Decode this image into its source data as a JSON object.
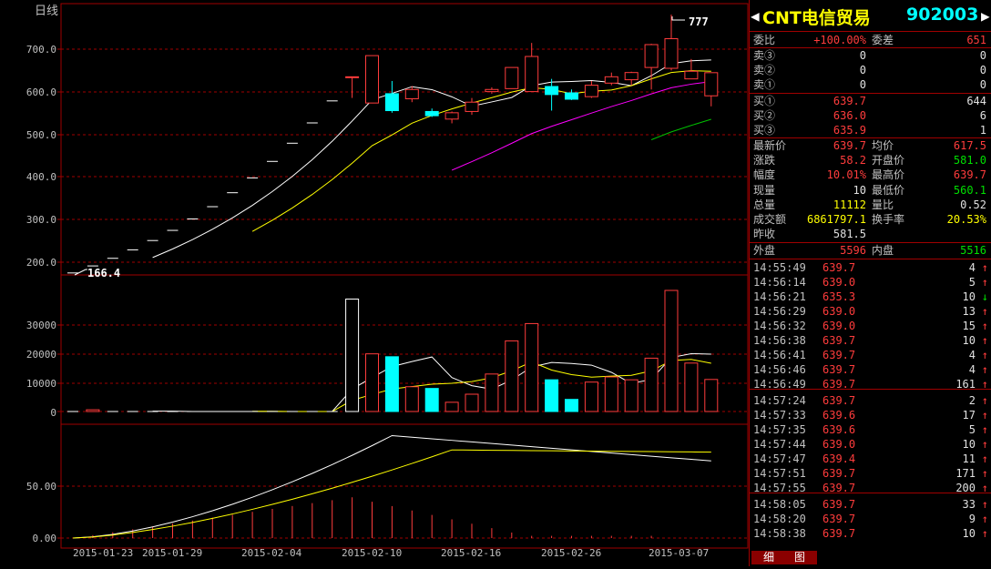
{
  "chart": {
    "period_label": "日线",
    "high_marker": "777",
    "low_marker": "166.4",
    "price_ticks": [
      "700.0",
      "600.0",
      "500.0",
      "400.0",
      "300.0",
      "200.0"
    ],
    "volume_ticks": [
      "30000",
      "20000",
      "10000",
      "0"
    ],
    "indicator_ticks": [
      "50.00",
      "0.00"
    ],
    "date_labels": [
      "2015-01-23",
      "2015-01-29",
      "2015-02-04",
      "2015-02-10",
      "2015-02-16",
      "2015-02-26",
      "2015-03-07"
    ]
  },
  "chart_data": {
    "type": "candlestick",
    "price_axis_range": [
      166,
      777
    ],
    "volume_axis_range": [
      0,
      40000
    ],
    "candles": [
      {
        "o": 166.4,
        "h": 166.4,
        "l": 166.4,
        "c": 166.4,
        "v": 0
      },
      {
        "o": 183,
        "h": 183,
        "l": 183,
        "c": 183,
        "v": 600
      },
      {
        "o": 201,
        "h": 201,
        "l": 201,
        "c": 201,
        "v": 0
      },
      {
        "o": 221,
        "h": 221,
        "l": 221,
        "c": 221,
        "v": 0
      },
      {
        "o": 243,
        "h": 243,
        "l": 243,
        "c": 243,
        "v": 0
      },
      {
        "o": 267,
        "h": 267,
        "l": 267,
        "c": 267,
        "v": 0
      },
      {
        "o": 294,
        "h": 294,
        "l": 294,
        "c": 294,
        "v": 0
      },
      {
        "o": 323,
        "h": 323,
        "l": 323,
        "c": 323,
        "v": 0
      },
      {
        "o": 356,
        "h": 356,
        "l": 356,
        "c": 356,
        "v": 0
      },
      {
        "o": 391,
        "h": 391,
        "l": 391,
        "c": 391,
        "v": 0
      },
      {
        "o": 430,
        "h": 430,
        "l": 430,
        "c": 430,
        "v": 0
      },
      {
        "o": 473,
        "h": 473,
        "l": 473,
        "c": 473,
        "v": 0
      },
      {
        "o": 521,
        "h": 521,
        "l": 521,
        "c": 521,
        "v": 0
      },
      {
        "o": 573,
        "h": 573,
        "l": 573,
        "c": 573,
        "v": 0
      },
      {
        "o": 630,
        "h": 630,
        "l": 580,
        "c": 630,
        "v": 39000
      },
      {
        "o": 568,
        "h": 680,
        "l": 568,
        "c": 680,
        "v": 20000
      },
      {
        "o": 590,
        "h": 620,
        "l": 545,
        "c": 550,
        "v": 19000
      },
      {
        "o": 578,
        "h": 608,
        "l": 570,
        "c": 600,
        "v": 8600
      },
      {
        "o": 548,
        "h": 555,
        "l": 535,
        "c": 538,
        "v": 8000
      },
      {
        "o": 530,
        "h": 548,
        "l": 520,
        "c": 545,
        "v": 3200
      },
      {
        "o": 548,
        "h": 580,
        "l": 540,
        "c": 570,
        "v": 6000
      },
      {
        "o": 595,
        "h": 605,
        "l": 590,
        "c": 600,
        "v": 13000
      },
      {
        "o": 602,
        "h": 652,
        "l": 602,
        "c": 652,
        "v": 24500
      },
      {
        "o": 595,
        "h": 710,
        "l": 595,
        "c": 678,
        "v": 30500
      },
      {
        "o": 607,
        "h": 625,
        "l": 550,
        "c": 588,
        "v": 11000
      },
      {
        "o": 592,
        "h": 600,
        "l": 575,
        "c": 577,
        "v": 4200
      },
      {
        "o": 583,
        "h": 620,
        "l": 580,
        "c": 610,
        "v": 10200
      },
      {
        "o": 615,
        "h": 640,
        "l": 610,
        "c": 630,
        "v": 12000
      },
      {
        "o": 623,
        "h": 642,
        "l": 610,
        "c": 640,
        "v": 11000
      },
      {
        "o": 652,
        "h": 708,
        "l": 600,
        "c": 706,
        "v": 18500
      },
      {
        "o": 650,
        "h": 777,
        "l": 645,
        "c": 720,
        "v": 42000
      },
      {
        "o": 625,
        "h": 672,
        "l": 625,
        "c": 643,
        "v": 16800
      },
      {
        "o": 585,
        "h": 639.7,
        "l": 560.1,
        "c": 639.7,
        "v": 11112
      }
    ]
  },
  "quote": {
    "title_name": "CNT电信贸易",
    "title_code": "902003",
    "weibi_label": "委比",
    "weibi_value": "+100.00%",
    "weicha_label": "委差",
    "weicha_value": "651",
    "sells": [
      {
        "label": "卖③",
        "price": "0",
        "qty": "0"
      },
      {
        "label": "卖②",
        "price": "0",
        "qty": "0"
      },
      {
        "label": "卖①",
        "price": "0",
        "qty": "0"
      }
    ],
    "buys": [
      {
        "label": "买①",
        "price": "639.7",
        "qty": "644"
      },
      {
        "label": "买②",
        "price": "636.0",
        "qty": "6"
      },
      {
        "label": "买③",
        "price": "635.9",
        "qty": "1"
      }
    ],
    "stats": [
      {
        "l1": "最新价",
        "v1": "639.7",
        "l2": "均价",
        "v2": "617.5"
      },
      {
        "l1": "涨跌",
        "v1": "58.2",
        "l2": "开盘价",
        "v2": "581.0"
      },
      {
        "l1": "幅度",
        "v1": "10.01%",
        "l2": "最高价",
        "v2": "639.7"
      },
      {
        "l1": "现量",
        "v1": "10",
        "l2": "最低价",
        "v2": "560.1"
      },
      {
        "l1": "总量",
        "v1": "11112",
        "l2": "量比",
        "v2": "0.52"
      },
      {
        "l1": "成交额",
        "v1": "6861797.1",
        "l2": "换手率",
        "v2": "20.53%"
      }
    ],
    "zuoshou_label": "昨收",
    "zuoshou_value": "581.5",
    "waipan_label": "外盘",
    "waipan_value": "5596",
    "neipan_label": "内盘",
    "neipan_value": "5516"
  },
  "trades": [
    {
      "time": "14:55:49",
      "price": "639.7",
      "qty": "4",
      "dir": "↑"
    },
    {
      "time": "14:56:14",
      "price": "639.0",
      "qty": "5",
      "dir": "↑"
    },
    {
      "time": "14:56:21",
      "price": "635.3",
      "qty": "10",
      "dir": "↓"
    },
    {
      "time": "14:56:29",
      "price": "639.0",
      "qty": "13",
      "dir": "↑"
    },
    {
      "time": "14:56:32",
      "price": "639.0",
      "qty": "15",
      "dir": "↑"
    },
    {
      "time": "14:56:38",
      "price": "639.7",
      "qty": "10",
      "dir": "↑"
    },
    {
      "time": "14:56:41",
      "price": "639.7",
      "qty": "4",
      "dir": "↑"
    },
    {
      "time": "14:56:46",
      "price": "639.7",
      "qty": "4",
      "dir": "↑"
    },
    {
      "time": "14:56:49",
      "price": "639.7",
      "qty": "161",
      "dir": "↑"
    },
    {
      "time": "14:57:24",
      "price": "639.7",
      "qty": "2",
      "dir": "↑"
    },
    {
      "time": "14:57:33",
      "price": "639.6",
      "qty": "17",
      "dir": "↑"
    },
    {
      "time": "14:57:35",
      "price": "639.6",
      "qty": "5",
      "dir": "↑"
    },
    {
      "time": "14:57:44",
      "price": "639.0",
      "qty": "10",
      "dir": "↑"
    },
    {
      "time": "14:57:47",
      "price": "639.4",
      "qty": "11",
      "dir": "↑"
    },
    {
      "time": "14:57:51",
      "price": "639.7",
      "qty": "171",
      "dir": "↑"
    },
    {
      "time": "14:57:55",
      "price": "639.7",
      "qty": "200",
      "dir": "↑"
    },
    {
      "time": "14:58:05",
      "price": "639.7",
      "qty": "33",
      "dir": "↑"
    },
    {
      "time": "14:58:20",
      "price": "639.7",
      "qty": "9",
      "dir": "↑"
    },
    {
      "time": "14:58:38",
      "price": "639.7",
      "qty": "10",
      "dir": "↑"
    }
  ],
  "tabs": {
    "detail": "细",
    "chart": "图"
  },
  "colors": {
    "up": "#ff3c3c",
    "down": "#00ffff",
    "grid": "#a00000",
    "ma5": "#ffffff",
    "ma10": "#ffff00",
    "ma20": "#ff00ff",
    "ma30": "#00c000"
  }
}
